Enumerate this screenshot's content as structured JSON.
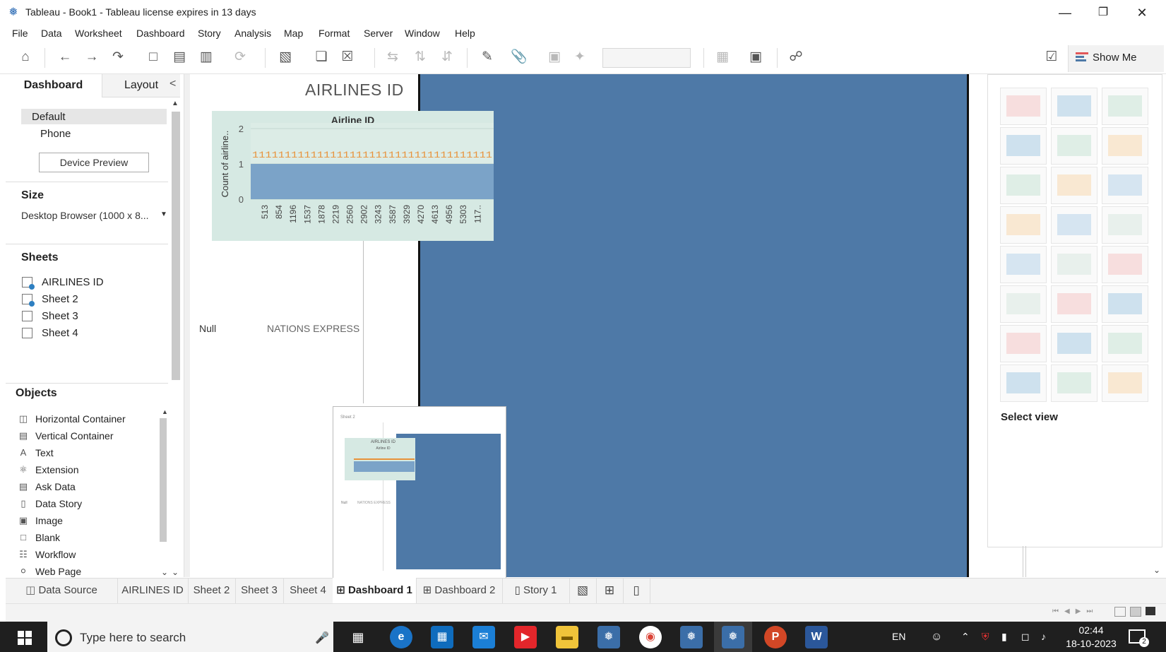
{
  "window": {
    "title": "Tableau - Book1 - Tableau license expires in 13 days",
    "minimize": "—",
    "restore": "❐",
    "close": "✕"
  },
  "menu": [
    "File",
    "Data",
    "Worksheet",
    "Dashboard",
    "Story",
    "Analysis",
    "Map",
    "Format",
    "Server",
    "Window",
    "Help"
  ],
  "toolbar": {
    "show_me": "Show Me"
  },
  "left_panel": {
    "tab_dashboard": "Dashboard",
    "tab_layout": "Layout",
    "collapse": "<",
    "devices": {
      "default": "Default",
      "phone": "Phone"
    },
    "device_preview_button": "Device Preview",
    "size_title": "Size",
    "size_value": "Desktop Browser (1000 x 8...",
    "sheets_title": "Sheets",
    "sheets": [
      "AIRLINES ID",
      "Sheet 2",
      "Sheet 3",
      "Sheet 4"
    ],
    "objects_title": "Objects",
    "objects": [
      "Horizontal Container",
      "Vertical Container",
      "Text",
      "Extension",
      "Ask Data",
      "Data Story",
      "Image",
      "Blank",
      "Workflow",
      "Web Page"
    ]
  },
  "dashboard": {
    "title": "AIRLINES ID",
    "null_label": "Null",
    "nations_label": "NATIONS EXPRESS",
    "thumbnail": {
      "sheet_label": "Sheet 2",
      "mini_title": "AIRLINES ID",
      "mini_chart_title": "Airline ID",
      "null_label": "Null",
      "nations_label": "NATIONS EXPRESS"
    }
  },
  "chart_data": {
    "type": "bar",
    "title": "Airline ID",
    "xlabel": "",
    "ylabel": "Count of airline..",
    "ylim": [
      0,
      2
    ],
    "yticks": [
      "2",
      "1",
      "0"
    ],
    "categories": [
      "513",
      "854",
      "1196",
      "1537",
      "1878",
      "2219",
      "2560",
      "2902",
      "3243",
      "3587",
      "3929",
      "4270",
      "4613",
      "4956",
      "5303",
      "117.."
    ],
    "values": [
      1,
      1,
      1,
      1,
      1,
      1,
      1,
      1,
      1,
      1,
      1,
      1,
      1,
      1,
      1,
      1
    ],
    "data_label_row": "1111111111111111111111111111111111111",
    "colors": {
      "bar": "#7ba3c8",
      "label": "#e8923a",
      "background": "#d6e9e3"
    }
  },
  "right_panel": {
    "select_view": "Select view"
  },
  "bottom_tabs": [
    "Data Source",
    "AIRLINES ID",
    "Sheet 2",
    "Sheet 3",
    "Sheet 4",
    "Dashboard 1",
    "Dashboard 2",
    "Story 1"
  ],
  "taskbar": {
    "search_placeholder": "Type here to search",
    "language": "EN",
    "time": "02:44",
    "date": "18-10-2023",
    "notification_count": "2"
  }
}
